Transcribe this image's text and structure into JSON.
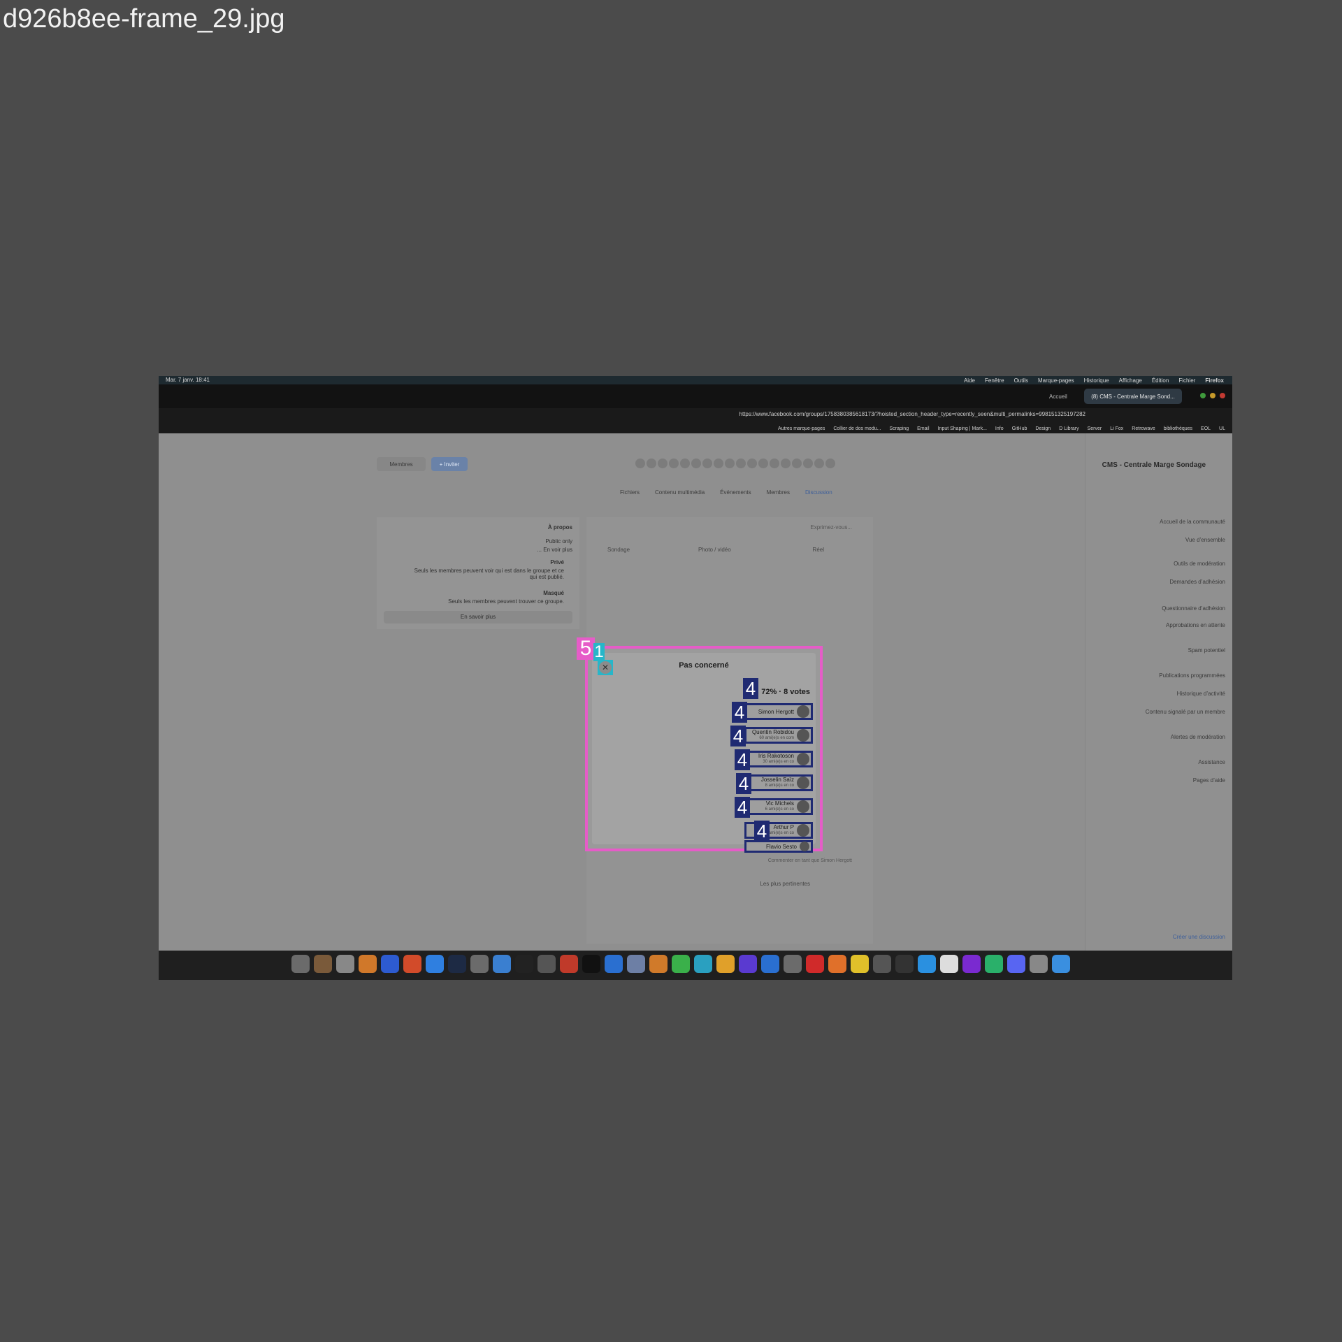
{
  "frame_label": "d926b8ee-frame_29.jpg",
  "menubar": {
    "items": [
      "Firefox",
      "Fichier",
      "Édition",
      "Affichage",
      "Historique",
      "Marque-pages",
      "Outils",
      "Fenêtre",
      "Aide"
    ],
    "clock": "Mar. 7 janv. 18:41"
  },
  "browser": {
    "tab_title": "(8) CMS - Centrale Marge Sond...",
    "tab2_title": "Accueil",
    "url": "https://www.facebook.com/groups/1758380385618173/?hoisted_section_header_type=recently_seen&multi_permalinks=998151325197282",
    "bookmarks": [
      "UL",
      "EOL",
      "bibliothèques",
      "Retrowave",
      "Li Fox",
      "Server",
      "D Library",
      "Design",
      "GitHub",
      "Info",
      "Input Shaping | Mark...",
      "Email",
      "Scraping",
      "Collier de dos modu...",
      "Autres marque-pages"
    ]
  },
  "facebook": {
    "group_name": "CMS - Centrale Marge Sondage",
    "sidebar": [
      "Accueil de la communauté",
      "Vue d’ensemble",
      "Outils de modération",
      "Demandes d’adhésion",
      "Questionnaire d’adhésion",
      "Approbations en attente",
      "Spam potentiel",
      "Publications programmées",
      "Historique d’activité",
      "Contenu signalé par un membre",
      "Alertes de modération",
      "Assistance",
      "Pages d’aide",
      "Créer une discussion"
    ],
    "tabs": [
      "Discussion",
      "Membres",
      "Événements",
      "Contenu multimédia",
      "Fichiers"
    ],
    "invite_label": "+ Inviter",
    "members_label": "Membres",
    "about": {
      "heading": "À propos",
      "lines": [
        "Public only",
        "... En voir plus",
        "Privé",
        "Seuls les membres peuvent voir qui est dans le groupe et ce qui est publié.",
        "Masqué",
        "Seuls les membres peuvent trouver ce groupe."
      ],
      "button": "En savoir plus"
    },
    "composer_placeholder": "Exprimez-vous...",
    "post_actions": [
      "Sondage",
      "Photo / vidéo",
      "Réel"
    ],
    "feed_footer": "Les plus pertinentes",
    "comment_placeholder": "Commenter en tant que Simon Hergott"
  },
  "modal": {
    "title": "Pas concerné",
    "close_icon": "close-icon",
    "summary": "72% · 8 votes",
    "voters": [
      {
        "name": "Simon Hergott",
        "sub": ""
      },
      {
        "name": "Quentin Robidou",
        "sub": "60 ami(e)s en com"
      },
      {
        "name": "Iris Rakotoson",
        "sub": "30 ami(e)s en co"
      },
      {
        "name": "Josselin Saïz",
        "sub": "8 ami(e)s en co"
      },
      {
        "name": "Vic Michels",
        "sub": "6 ami(e)s en co"
      },
      {
        "name": "Arthur P",
        "sub": "10 ami(e)s en co"
      },
      {
        "name": "Flavio Sesto",
        "sub": ""
      }
    ]
  },
  "annotations": {
    "box5": "5",
    "box1": "1",
    "voter_badge": "4"
  },
  "colors": {
    "background": "#4b4b4b",
    "modal_border": "#e65cc8",
    "close_highlight": "#27b6c9",
    "voter_highlight": "#1f2a72"
  }
}
